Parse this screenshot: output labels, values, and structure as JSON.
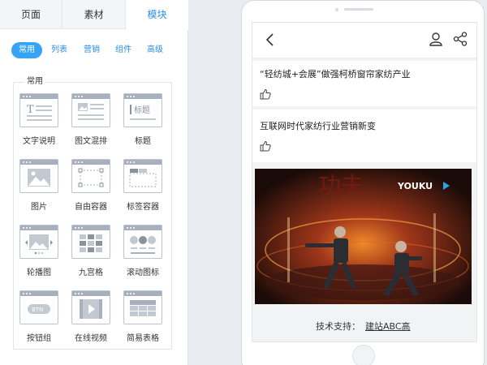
{
  "top_tabs": [
    {
      "label": "页面"
    },
    {
      "label": "素材"
    },
    {
      "label": "模块",
      "active": true
    }
  ],
  "sub_tabs": [
    {
      "label": "常用",
      "active": true
    },
    {
      "label": "列表"
    },
    {
      "label": "营销"
    },
    {
      "label": "组件"
    },
    {
      "label": "高级"
    }
  ],
  "group": {
    "label": "常用",
    "widgets": [
      {
        "label": "文字说明",
        "icon": "text-block-icon"
      },
      {
        "label": "图文混排",
        "icon": "image-text-icon"
      },
      {
        "label": "标题",
        "icon": "heading-icon",
        "icon_text": "标题"
      },
      {
        "label": "图片",
        "icon": "image-icon"
      },
      {
        "label": "自由容器",
        "icon": "free-container-icon"
      },
      {
        "label": "标签容器",
        "icon": "tab-container-icon"
      },
      {
        "label": "轮播图",
        "icon": "carousel-icon"
      },
      {
        "label": "九宫格",
        "icon": "grid-icon"
      },
      {
        "label": "滚动图标",
        "icon": "scroll-icons-icon"
      },
      {
        "label": "按钮组",
        "icon": "button-group-icon",
        "icon_text": "BTN"
      },
      {
        "label": "在线视频",
        "icon": "video-icon"
      },
      {
        "label": "简易表格",
        "icon": "table-icon"
      }
    ]
  },
  "phone": {
    "nav": {
      "back_icon": "chevron-left-icon",
      "user_icon": "user-icon",
      "share_icon": "share-icon"
    },
    "articles": [
      {
        "title": "“轻纺城+会展”做强柯桥窗帘家纺产业",
        "icon": "thumbs-up-icon"
      },
      {
        "title": "互联网时代家纺行业营销新变",
        "icon": "thumbs-up-icon"
      }
    ],
    "video": {
      "brand": "YOUKU",
      "backdrop_text": "功夫"
    },
    "support": {
      "label": "技术支持：",
      "link": "建站ABC高"
    }
  },
  "colors": {
    "accent": "#2a8ce5",
    "active_pill": "#37a3f5",
    "icon_gray": "#a8b1bb"
  }
}
